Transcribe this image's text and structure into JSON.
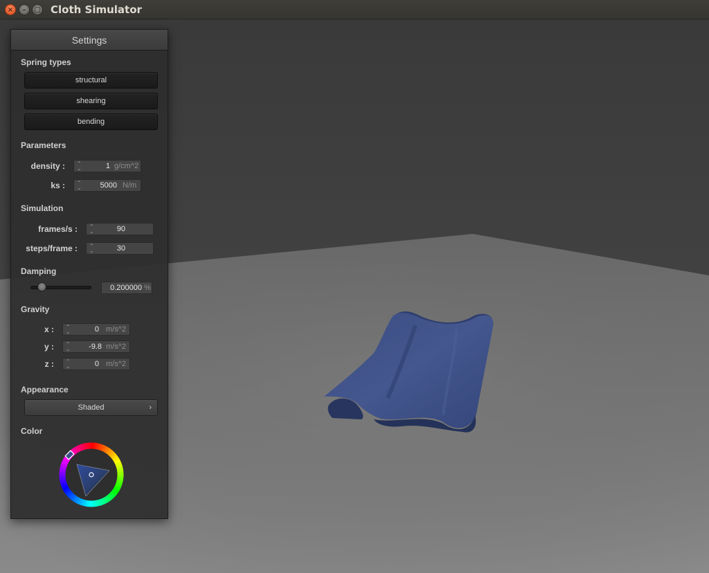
{
  "window": {
    "title": "Cloth Simulator"
  },
  "window_buttons": {
    "close": "×",
    "minimize": "–",
    "maximize": "□"
  },
  "panel": {
    "title": "Settings",
    "spring_types": {
      "label": "Spring types",
      "buttons": [
        "structural",
        "shearing",
        "bending"
      ]
    },
    "parameters": {
      "label": "Parameters",
      "density": {
        "label": "density :",
        "value": "1",
        "unit": "g/cm^2"
      },
      "ks": {
        "label": "ks :",
        "value": "5000",
        "unit": "N/m"
      }
    },
    "simulation": {
      "label": "Simulation",
      "fps": {
        "label": "frames/s :",
        "value": "90"
      },
      "steps": {
        "label": "steps/frame :",
        "value": "30"
      }
    },
    "damping": {
      "label": "Damping",
      "value": "0.200000",
      "unit": "%",
      "slider_fraction": 0.2
    },
    "gravity": {
      "label": "Gravity",
      "x": {
        "label": "x :",
        "value": "0",
        "unit": "m/s^2"
      },
      "y": {
        "label": "y :",
        "value": "-9.8",
        "unit": "m/s^2"
      },
      "z": {
        "label": "z :",
        "value": "0",
        "unit": "m/s^2"
      }
    },
    "appearance": {
      "label": "Appearance",
      "selected": "Shaded",
      "chevron": "›"
    },
    "color": {
      "label": "Color",
      "current": "#2f3f70"
    }
  },
  "scene": {
    "background_color": "#3f3f3f",
    "floor_color": "#6e6e6e",
    "cloth_color": "#2f3f70"
  }
}
